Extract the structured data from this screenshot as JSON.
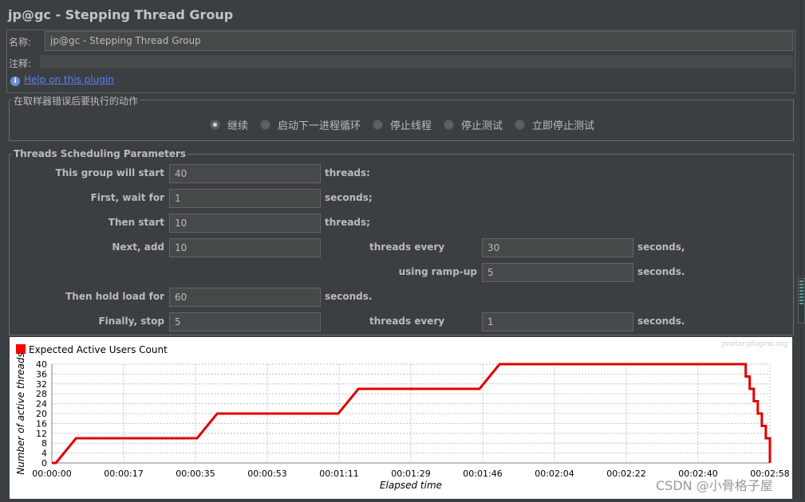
{
  "window": {
    "title": "jp@gc - Stepping Thread Group"
  },
  "name_section": {
    "name_label": "名称:",
    "name_value": "jp@gc - Stepping Thread Group",
    "comment_label": "注释:",
    "comment_value": "",
    "help_link": "Help on this plugin"
  },
  "on_error": {
    "legend": "在取样器错误后要执行的动作",
    "options": [
      {
        "label": "继续",
        "selected": true
      },
      {
        "label": "启动下一进程循环",
        "selected": false
      },
      {
        "label": "停止线程",
        "selected": false
      },
      {
        "label": "停止测试",
        "selected": false
      },
      {
        "label": "立即停止测试",
        "selected": false
      }
    ]
  },
  "scheduling": {
    "legend": "Threads Scheduling Parameters",
    "start_label": "This group will start",
    "start_value": "40",
    "start_unit": "threads:",
    "wait_label": "First, wait for",
    "wait_value": "1",
    "wait_unit": "seconds;",
    "then_start_label": "Then start",
    "then_start_value": "10",
    "then_start_unit": "threads;",
    "next_add_label": "Next, add",
    "next_add_value": "10",
    "threads_every_label": "threads every",
    "threads_every_value": "30",
    "threads_every_unit": "seconds,",
    "rampup_label": "using ramp-up",
    "rampup_value": "5",
    "rampup_unit": "seconds.",
    "hold_label": "Then hold load for",
    "hold_value": "60",
    "hold_unit": "seconds.",
    "stop_label": "Finally, stop",
    "stop_value": "5",
    "stop_threads_every_label": "threads every",
    "stop_every_value": "1",
    "stop_every_unit": "seconds."
  },
  "chart_data": {
    "type": "line",
    "title": "",
    "legend": "Expected Active Users Count",
    "legend_color": "#ff0000",
    "series_color": "#e00000",
    "credit": "jmeter-plugins.org",
    "xlabel": "Elapsed time",
    "ylabel": "Number of active threads",
    "ylim": [
      0,
      40
    ],
    "yticks": [
      0,
      4,
      8,
      12,
      16,
      20,
      24,
      28,
      32,
      36,
      40
    ],
    "xlim_seconds": [
      0,
      178
    ],
    "xticks": [
      {
        "t": 0,
        "label": "00:00:00"
      },
      {
        "t": 17.8,
        "label": "00:00:17"
      },
      {
        "t": 35.6,
        "label": "00:00:35"
      },
      {
        "t": 53.4,
        "label": "00:00:53"
      },
      {
        "t": 71.2,
        "label": "00:01:11"
      },
      {
        "t": 89.0,
        "label": "00:01:29"
      },
      {
        "t": 106.8,
        "label": "00:01:46"
      },
      {
        "t": 124.6,
        "label": "00:02:04"
      },
      {
        "t": 142.4,
        "label": "00:02:22"
      },
      {
        "t": 160.2,
        "label": "00:02:40"
      },
      {
        "t": 178,
        "label": "00:02:58"
      }
    ],
    "grid": true,
    "legend_position": "top-left",
    "points": [
      [
        0,
        0
      ],
      [
        1,
        0
      ],
      [
        6,
        10
      ],
      [
        36,
        10
      ],
      [
        41,
        20
      ],
      [
        71,
        20
      ],
      [
        76,
        30
      ],
      [
        106,
        30
      ],
      [
        111,
        40
      ],
      [
        171,
        40
      ],
      [
        172,
        40
      ],
      [
        172,
        35
      ],
      [
        173,
        35
      ],
      [
        173,
        30
      ],
      [
        174,
        30
      ],
      [
        174,
        25
      ],
      [
        175,
        25
      ],
      [
        175,
        20
      ],
      [
        176,
        20
      ],
      [
        176,
        15
      ],
      [
        177,
        15
      ],
      [
        177,
        10
      ],
      [
        178,
        10
      ],
      [
        178,
        5
      ],
      [
        179,
        5
      ],
      [
        179,
        0
      ]
    ]
  },
  "watermark": "CSDN @小骨格子屋"
}
